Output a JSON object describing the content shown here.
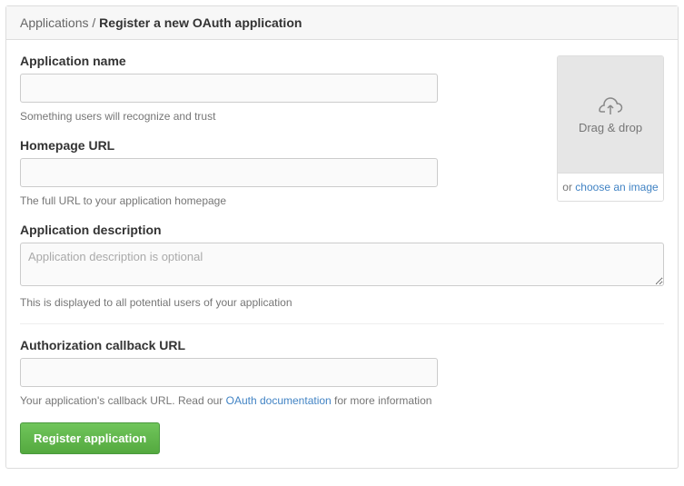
{
  "breadcrumb": {
    "parent": "Applications",
    "separator": " / ",
    "title": "Register a new OAuth application"
  },
  "fields": {
    "name": {
      "label": "Application name",
      "value": "",
      "help": "Something users will recognize and trust"
    },
    "homepage": {
      "label": "Homepage URL",
      "value": "",
      "help": "The full URL to your application homepage"
    },
    "description": {
      "label": "Application description",
      "placeholder": "Application description is optional",
      "value": "",
      "help": "This is displayed to all potential users of your application"
    },
    "callback": {
      "label": "Authorization callback URL",
      "value": "",
      "help_prefix": "Your application's callback URL. Read our ",
      "help_link": "OAuth documentation",
      "help_suffix": " for more information"
    }
  },
  "logo": {
    "drop_label": "Drag & drop",
    "or_text": "or ",
    "choose_link": "choose an image"
  },
  "submit_label": "Register application"
}
